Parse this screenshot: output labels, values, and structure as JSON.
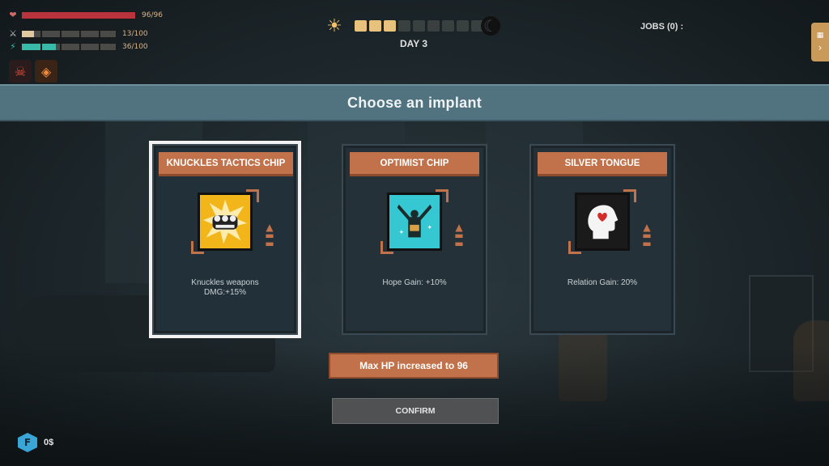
{
  "hud": {
    "health": {
      "icon": "heart-icon",
      "value": "96/96",
      "fill": 1.0,
      "color": "#b8333b"
    },
    "stamina": {
      "icon": "crossed-swords-icon",
      "value": "13/100",
      "fill": 0.13,
      "color": "#e1c8a0"
    },
    "energy": {
      "icon": "lightning-icon",
      "value": "36/100",
      "fill": 0.36,
      "color": "#39b9a7"
    },
    "status_icons": [
      "skull-icon",
      "fire-icon"
    ]
  },
  "day": {
    "label": "DAY 3",
    "segments_total": 9,
    "segments_filled": 3
  },
  "jobs": {
    "label": "JOBS (0) :"
  },
  "banner": {
    "title": "Choose an implant"
  },
  "cards": [
    {
      "title": "KNUCKLES TACTICS CHIP",
      "icon": "knuckles-icon",
      "description": "Knuckles weapons\nDMG:+15%",
      "selected": true,
      "icon_bg": "#f2b61b"
    },
    {
      "title": "OPTIMIST CHIP",
      "icon": "cheering-figure-icon",
      "description": "Hope Gain: +10%",
      "selected": false,
      "icon_bg": "#35c8d2"
    },
    {
      "title": "SILVER TONGUE",
      "icon": "head-heart-icon",
      "description": "Relation Gain: 20%",
      "selected": false,
      "icon_bg": "#1a1a1a"
    }
  ],
  "hp_notice": "Max HP increased to 96",
  "confirm_label": "CONFIRM",
  "money": {
    "value": "0$",
    "icon": "currency-icon"
  }
}
